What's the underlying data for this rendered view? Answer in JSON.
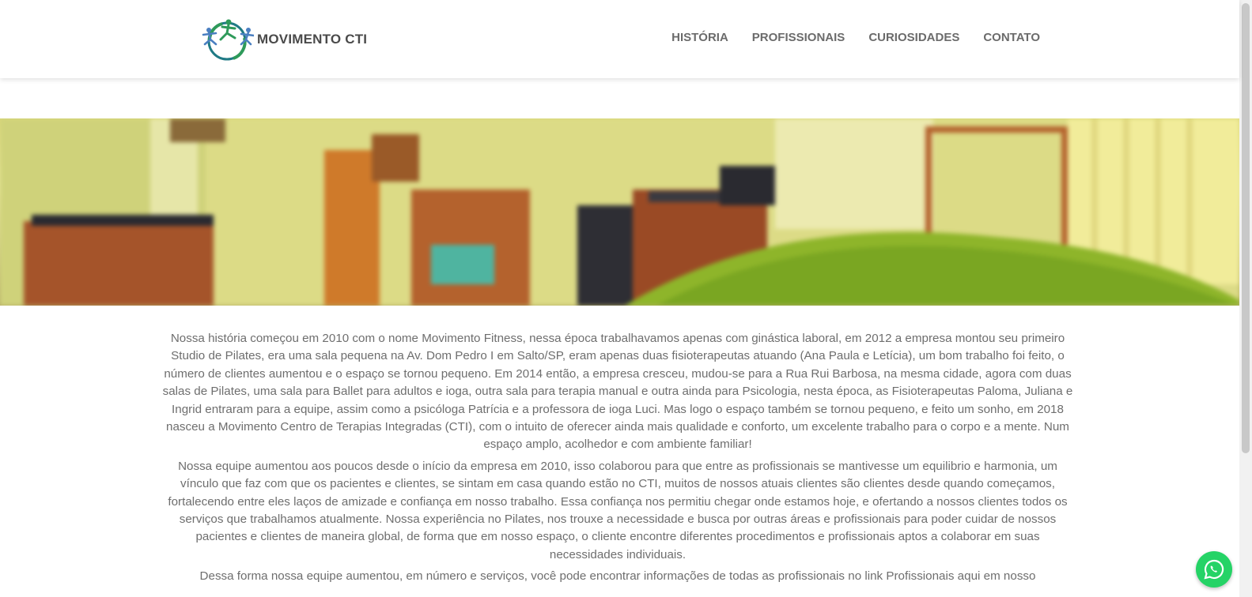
{
  "brand": {
    "name": "MOVIMENTO CTI",
    "logo_icon": "leaping-figures-logo-icon",
    "colors": {
      "green": "#2e9a5a",
      "blue": "#4a7fc1",
      "teal": "#1f7a85"
    }
  },
  "nav": {
    "items": [
      {
        "label": "HISTÓRIA"
      },
      {
        "label": "PROFISSIONAIS"
      },
      {
        "label": "CURIOSIDADES"
      },
      {
        "label": "CONTATO"
      }
    ]
  },
  "hero": {
    "description_icon": "pilates-studio-image"
  },
  "content": {
    "paragraphs": [
      "Nossa história começou em 2010 com o nome Movimento Fitness, nessa época trabalhavamos apenas com ginástica laboral, em 2012 a empresa montou seu primeiro Studio de Pilates, era uma sala pequena na Av. Dom Pedro I em Salto/SP, eram apenas duas fisioterapeutas atuando (Ana Paula e Letícia), um bom trabalho foi feito, o número de clientes aumentou e o espaço se tornou pequeno. Em 2014 então, a empresa cresceu, mudou-se para a Rua Rui Barbosa, na mesma cidade, agora com duas salas de Pilates, uma sala para Ballet para adultos e ioga, outra sala para terapia manual e outra ainda para Psicologia, nesta época, as Fisioterapeutas Paloma, Juliana e Ingrid entraram para a equipe, assim como a psicóloga Patrícia e a professora de ioga Luci. Mas logo o espaço também se tornou pequeno, e feito um sonho, em 2018 nasceu a Movimento Centro de Terapias Integradas (CTI), com o intuito de oferecer ainda mais qualidade e conforto, um excelente trabalho para o corpo e a mente. Num espaço amplo, acolhedor e com ambiente familiar!",
      "Nossa equipe aumentou aos poucos desde o início da empresa em 2010, isso colaborou para que entre as profissionais se mantivesse um equilibrio e harmonia, um vínculo que faz com que os pacientes e clientes, se sintam em casa quando estão no CTI, muitos de nossos atuais clientes são clientes desde quando começamos, fortalecendo entre eles laços de amizade e confiança em nosso trabalho. Essa confiança nos permitiu chegar onde estamos hoje, e ofertando a nossos clientes todos os serviços que trabalhamos atualmente. Nossa experiência no Pilates, nos trouxe a necessidade e busca por outras áreas e profissionais para poder cuidar de nossos pacientes e clientes de maneira global, de forma que em nosso espaço, o cliente encontre diferentes procedimentos e profissionais aptos a colaborar em suas necessidades individuais.",
      "Dessa forma nossa equipe aumentou, em número e serviços, você pode encontrar informações de todas as profissionais no link Profissionais aqui em nosso"
    ]
  },
  "whatsapp": {
    "icon": "whatsapp-icon",
    "color": "#25d366"
  }
}
